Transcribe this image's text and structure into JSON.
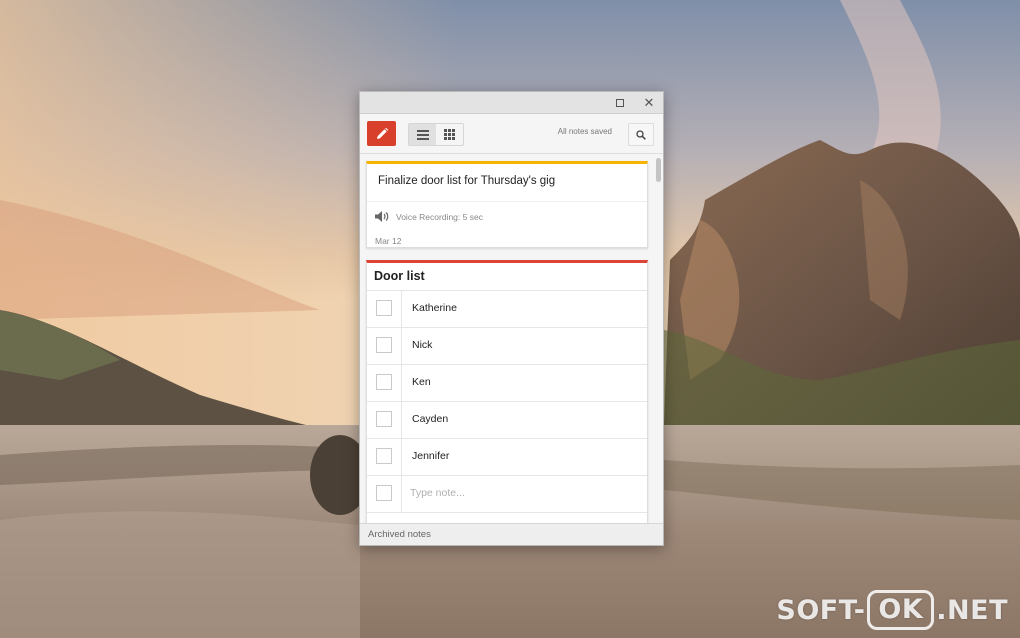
{
  "window": {
    "controls": {
      "maximize_icon": "maximize-icon",
      "close_icon": "close-icon",
      "close_glyph": "✕"
    }
  },
  "toolbar": {
    "new_note_icon": "pencil-icon",
    "list_view_icon": "list-view-icon",
    "grid_view_icon": "grid-view-icon",
    "active_view": "list",
    "save_status": "All notes saved",
    "search_icon": "search-icon"
  },
  "notes": [
    {
      "title": "Finalize door list for Thursday's gig",
      "accent_color": "#f4b400",
      "attachment": {
        "icon": "speaker-icon",
        "label": "Voice Recording: 5 sec"
      },
      "date": "Mar 12"
    },
    {
      "title": "Door list",
      "accent_color": "#db4437",
      "items": [
        {
          "text": "Katherine",
          "checked": false
        },
        {
          "text": "Nick",
          "checked": false
        },
        {
          "text": "Ken",
          "checked": false
        },
        {
          "text": "Cayden",
          "checked": false
        },
        {
          "text": "Jennifer",
          "checked": false
        }
      ],
      "new_item_placeholder": "Type note..."
    }
  ],
  "footer": {
    "archived_label": "Archived notes"
  },
  "colors": {
    "brand_red": "#d9402b",
    "accent_yellow": "#f4b400",
    "accent_red": "#db4437"
  },
  "watermark": {
    "left": "SOFT-",
    "boxed": "OK",
    "right": ".NET"
  }
}
